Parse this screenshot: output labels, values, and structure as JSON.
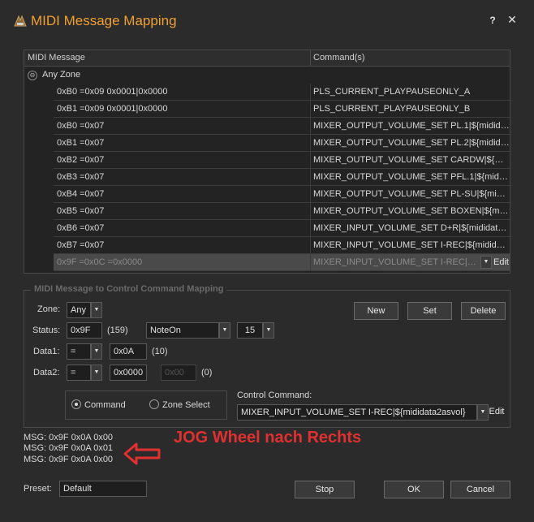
{
  "window": {
    "title": "MIDI Message Mapping",
    "help_label": "?",
    "close_label": "✕"
  },
  "table": {
    "headers": {
      "message": "MIDI Message",
      "commands": "Command(s)"
    },
    "group": {
      "toggle": "⊖",
      "label": "Any Zone"
    },
    "rows": [
      {
        "message": "0xB0 =0x09 0x0001|0x0000",
        "command": "PLS_CURRENT_PLAYPAUSEONLY_A"
      },
      {
        "message": "0xB1 =0x09 0x0001|0x0000",
        "command": "PLS_CURRENT_PLAYPAUSEONLY_B"
      },
      {
        "message": "0xB0 =0x07",
        "command": "MIXER_OUTPUT_VOLUME_SET PL.1|${mididata..."
      },
      {
        "message": "0xB1 =0x07",
        "command": "MIXER_OUTPUT_VOLUME_SET PL.2|${mididata..."
      },
      {
        "message": "0xB2 =0x07",
        "command": "MIXER_OUTPUT_VOLUME_SET CARDW|${midid..."
      },
      {
        "message": "0xB3 =0x07",
        "command": "MIXER_OUTPUT_VOLUME_SET PFL.1|${midiat..."
      },
      {
        "message": "0xB4 =0x07",
        "command": "MIXER_OUTPUT_VOLUME_SET PL-SU|${midiat..."
      },
      {
        "message": "0xB5 =0x07",
        "command": "MIXER_OUTPUT_VOLUME_SET BOXEN|${midida..."
      },
      {
        "message": "0xB6 =0x07",
        "command": "MIXER_INPUT_VOLUME_SET D+R|${mididata2a..."
      },
      {
        "message": "0xB7 =0x07",
        "command": "MIXER_INPUT_VOLUME_SET I-REC|${mididata2..."
      }
    ],
    "selected_row": {
      "message": "0x9F =0x0C =0x0000",
      "command": "MIXER_INPUT_VOLUME_SET I-REC|${mi...",
      "dropdown_icon": "▼",
      "edit_label": "Edit"
    }
  },
  "mapping": {
    "title": "MIDI Message to Control Command Mapping",
    "zone_label": "Zone:",
    "zone_value": "Any",
    "status_label": "Status:",
    "status_value": "0x9F",
    "status_decimal": "(159)",
    "status_type": "NoteOn",
    "channel": "15",
    "data1_label": "Data1:",
    "data1_op": "=",
    "data1_value": "0x0A",
    "data1_decimal": "(10)",
    "data2_label": "Data2:",
    "data2_op": "=",
    "data2_value": "0x0000",
    "data2_value2": "0x00",
    "data2_decimal": "(0)",
    "new_label": "New",
    "set_label": "Set",
    "delete_label": "Delete",
    "radio_command": "Command",
    "radio_zone_select": "Zone Select",
    "control_command_label": "Control Command:",
    "control_command_value": "MIXER_INPUT_VOLUME_SET I-REC|${mididata2asvol}",
    "edit_label": "Edit",
    "dropdown_icon": "▼"
  },
  "log": {
    "lines": [
      "MSG: 0x9F 0x0A 0x00",
      "MSG: 0x9F 0x0A 0x01",
      "MSG: 0x9F 0x0A 0x00"
    ],
    "annotation": "JOG Wheel nach Rechts"
  },
  "footer": {
    "preset_label": "Preset:",
    "preset_value": "Default",
    "stop_label": "Stop",
    "ok_label": "OK",
    "cancel_label": "Cancel"
  },
  "colors": {
    "title": "#f0a030",
    "annotation": "#e03030",
    "background": "#2b2b2b"
  }
}
